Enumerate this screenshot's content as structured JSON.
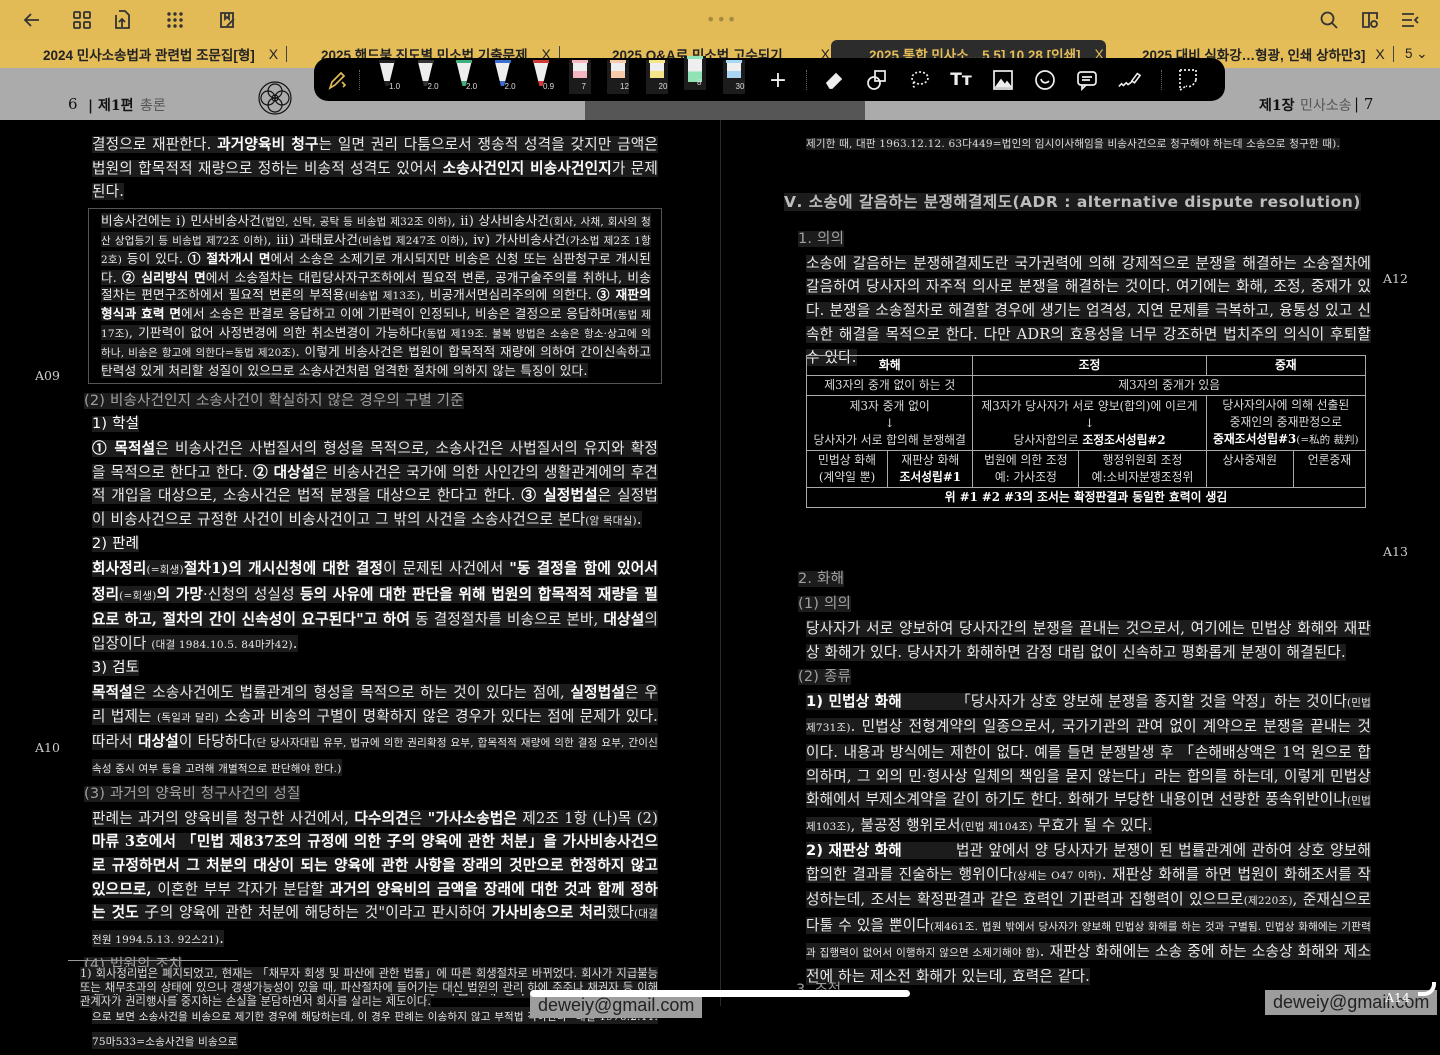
{
  "tabs": [
    {
      "label": "2024 민사소송법과 관련법 조문집[형]",
      "active": false
    },
    {
      "label": "2025 핸드북 진도별 민소법 기출문제",
      "active": false
    },
    {
      "label": "2025 Q&A로 민소법 고수되기",
      "active": false
    },
    {
      "label": "2025 통합 민사소…5 5] 10.28.[인쇄]",
      "active": true
    },
    {
      "label": "2025 대비 심화강…형광, 인쇄 상하만3]",
      "active": false
    }
  ],
  "tab_close": "X",
  "tab_count": "5 ⌄",
  "topbar_dots": "•••",
  "toolbar": {
    "pens": [
      {
        "size": "1.0",
        "color": "#222222",
        "kind": "pen"
      },
      {
        "size": "2.0",
        "color": "#333333",
        "kind": "pen"
      },
      {
        "size": "2.0",
        "color": "#3fae7a",
        "kind": "pen"
      },
      {
        "size": "2.0",
        "color": "#3a6fd0",
        "kind": "pen"
      },
      {
        "size": "0.9",
        "color": "#d23a3a",
        "kind": "pen"
      },
      {
        "size": "7",
        "color": "#f4b6c0",
        "kind": "highlighter"
      },
      {
        "size": "12",
        "color": "#f6c9a8",
        "kind": "highlighter"
      },
      {
        "size": "20",
        "color": "#f4e58a",
        "kind": "highlighter"
      },
      {
        "size": "8",
        "color": "#8fe3b5",
        "kind": "highlighter",
        "selected": true
      },
      {
        "size": "30",
        "color": "#a9d6f2",
        "kind": "highlighter"
      }
    ],
    "add": "+"
  },
  "left_header": {
    "page": "6",
    "part": "제1편",
    "title": "총론"
  },
  "right_header": {
    "chapter": "제1장",
    "title": "민사소송",
    "page": "7"
  },
  "margin_labels": {
    "a09": "A09",
    "a10": "A10",
    "a12": "A12",
    "a13": "A13",
    "a14": "A14"
  },
  "left_blocks": [
    {
      "type": "p",
      "segs": [
        [
          "결정으로 재판한다. "
        ],
        [
          "과거양육비 청구",
          "b"
        ],
        [
          "는 일면 권리 다툼으로서 쟁송적 성격을 갖지만 금액은 법원의 합목적적 재량으로 정하는 비송적 성격도 있어서 "
        ],
        [
          "소송사건인지 비송사건인지",
          "b"
        ],
        [
          "가 문제된다."
        ]
      ]
    },
    {
      "type": "box",
      "segs": [
        [
          "비송사건에는 ⅰ) 민사비송사건"
        ],
        [
          "(법인, 신탁, 공탁 등 비송법 제32조 이하)",
          "s"
        ],
        [
          ", ⅱ) 상사비송사건"
        ],
        [
          "(회사, 사채, 회사의 청산 상업등기 등 비송법 제72조 이하)",
          "s"
        ],
        [
          ", ⅲ) 과태료사건"
        ],
        [
          "(비송법 제247조 이하)",
          "s"
        ],
        [
          ", ⅳ) 가사비송사건"
        ],
        [
          "(가소법 제2조 1항 2호)",
          "s"
        ],
        [
          " 등이 있다. "
        ],
        [
          "① 절차개시 면",
          "b"
        ],
        [
          "에서 소송은 소제기로 개시되지만 비송은 신청 또는 심판청구로 개시된다. "
        ],
        [
          "② 심리방식 면",
          "b"
        ],
        [
          "에서 소송절차는 대립당사자구조하에서 필요적 변론, 공개구술주의를 취하나, 비송절차는 편면구조하에서 필요적 변론의 부적용"
        ],
        [
          "(비송법 제13조)",
          "s"
        ],
        [
          ", 비공개서면심리주의에 의한다. "
        ],
        [
          "③ 재판의 형식과 효력 면",
          "b"
        ],
        [
          "에서 소송은 판결로 응답하고 이에 기판력이 인정되나, 비송은 결정으로 응답하며"
        ],
        [
          "(동법 제17조)",
          "s"
        ],
        [
          ", 기판력이 없어 사정변경에 의한 취소변경이 가능하다"
        ],
        [
          "(동법 제19조. 불복 방법은 소송은 항소·상고에 의하나, 비송은 항고에 의한다=동법 제20조)",
          "s"
        ],
        [
          ". 이렇게 비송사건은 법원이 합목적적 재량에 의하여 간이신속하고 탄력성 있게 처리할 성질이 있으므로 소송사건처럼 엄격한 절차에 의하지 않는 특징이 있다."
        ]
      ]
    },
    {
      "type": "h2",
      "segs": [
        [
          "(2) 비송사건인지 소송사건이 확실하지 않은 경우의 구별 기준"
        ]
      ]
    },
    {
      "type": "h3",
      "segs": [
        [
          "1) 학설"
        ]
      ]
    },
    {
      "type": "p",
      "segs": [
        [
          "① 목적설",
          "b"
        ],
        [
          "은 비송사건은 사법질서의 형성을 목적으로, 소송사건은 사법질서의 유지와 확정을 목적으로 한다고 한다. "
        ],
        [
          "② 대상설",
          "b"
        ],
        [
          "은 비송사건은 국가에 의한 사인간의 생활관계에의 후견적 개입을 대상으로, 소송사건은 법적 분쟁을 대상으로 한다고 한다. "
        ],
        [
          "③ 실정법설",
          "b"
        ],
        [
          "은 실정법이 비송사건으로 규정한 사건이 비송사건이고 그 밖의 사건을 소송사건으로 본다"
        ],
        [
          "(암 목대실)",
          "s"
        ],
        [
          "."
        ]
      ]
    },
    {
      "type": "h3",
      "segs": [
        [
          "2) 판례"
        ]
      ]
    },
    {
      "type": "p",
      "segs": [
        [
          "회사정리",
          "b"
        ],
        [
          "(=회생)",
          "s"
        ],
        [
          "절차1)의 개시신청에 대한 결정",
          "b"
        ],
        [
          "이 문제된 사건에서 "
        ],
        [
          "\"동 결정을 함에 있어서 정리",
          "b"
        ],
        [
          "(=회생)",
          "s"
        ],
        [
          "의 가망",
          "b"
        ],
        [
          "·신청의 성실성 "
        ],
        [
          "등의 사유에 대한 판단을 위해 법원의 합목적적 재량을 필요로 하고, 절차의 간이 신속성이 요구된다\"고 하여",
          "b"
        ],
        [
          " 동 결정절차를 비송으로 본바, "
        ],
        [
          "대상설",
          "b"
        ],
        [
          "의 입장이다 "
        ],
        [
          "(대결 1984.10.5. 84마카42)",
          "s"
        ],
        [
          "."
        ]
      ]
    },
    {
      "type": "h3",
      "segs": [
        [
          "3) 검토"
        ]
      ]
    },
    {
      "type": "p",
      "segs": [
        [
          "목적설",
          "b"
        ],
        [
          "은 소송사건에도 법률관계의 형성을 목적으로 하는 것이 있다는 점에, "
        ],
        [
          "실정법설",
          "b"
        ],
        [
          "은 우리 법제는 "
        ],
        [
          "(독일과 달리)",
          "s"
        ],
        [
          " 소송과 비송의 구별이 명확하지 않은 경우가 있다는 점에 문제가 있다. 따라서 "
        ],
        [
          "대상설",
          "b"
        ],
        [
          "이 타당하다"
        ],
        [
          "(단 당사자대립 유무, 법규에 의한 권리확정 요부, 합목적적 재량에 의한 결정 요부, 간이신속성 중시 여부 등을 고려해 개별적으로 판단해야 한다.)",
          "s"
        ]
      ]
    },
    {
      "type": "h2",
      "segs": [
        [
          "(3) 과거의 양육비 청구사건의 성질"
        ]
      ]
    },
    {
      "type": "p",
      "segs": [
        [
          "판례는 과거의 양육비를 청구한 사건에서, "
        ],
        [
          "다수의견",
          "b"
        ],
        [
          "은 "
        ],
        [
          "\"가사소송법은",
          "b"
        ],
        [
          " 제2조 1항 (나)목 (2)"
        ],
        [
          "마류 3호에서 「민법 제837조의 규정에 의한 子의 양육에 관한 처분」을 가사비송사건으로 규정하면서 그 처분의 대상이 되는 양육에 관한 사항을 장래의 것만으로 한정하지 않고 있으므로,",
          "b"
        ],
        [
          " 이혼한 부부 각자가 분담할 "
        ],
        [
          "과거의 양육비의 금액을 장래에 대한 것과 함께 정하는 것도",
          "b"
        ],
        [
          " 子의 양육에 관한 처분에 해당하는 것\"이라고 판시하여 "
        ],
        [
          "가사비송으로 처리",
          "b"
        ],
        [
          "했다"
        ],
        [
          "(대결 전원 1994.5.13. 92스21)",
          "s"
        ],
        [
          "."
        ]
      ]
    },
    {
      "type": "h2",
      "segs": [
        [
          "(4) 법원의 조치"
        ]
      ]
    },
    {
      "type": "p",
      "segs": [
        [
          "판례처럼 과거양육비의 청구를 비송사건으로 보면 甲은 적법하게 청구한 것이다"
        ],
        [
          "(반면 소송사건으로 보면 소송사건을 비송으로 제기한 경우에 해당하는데, 이 경우 판례는 이송하지 않고 부적법 각하한다=대결 1976.2.11. 75마533=소송사건을 비송으로",
          "s"
        ]
      ]
    }
  ],
  "footnote": "1) 회사정리법은 폐지되었고, 현재는 「채무자 회생 및 파산에 관한 법률」에 따른 회생절차로 바뀌었다. 회사가 지급불능 또는 채무초과의 상태에 있으나 갱생가능성이 있을 때, 파산절차에 들어가는 대신 법원의 관리 하에 주주나 채권자 등 이해관계자가 권리행사를 중지하는 손실을 분담하면서 회사를 살리는 제도이다.",
  "right_blocks": [
    {
      "type": "note",
      "segs": [
        [
          "제기한 때, 대판 1963.12.12. 63다449=법인의 임시이사해임을 비송사건으로 청구해야 하는데 소송으로 청구한 때)."
        ]
      ]
    },
    {
      "type": "h1",
      "segs": [
        [
          "Ⅴ. 소송에 갈음하는 분쟁해결제도(ADR : alternative dispute resolution)"
        ]
      ]
    },
    {
      "type": "h2",
      "segs": [
        [
          "1. 의의"
        ]
      ]
    },
    {
      "type": "p",
      "segs": [
        [
          "소송에 갈음하는 분쟁해결제도란 국가권력에 의해 강제적으로 분쟁을 해결하는 소송절차에 갈음하여 당사자의 자주적 의사로 분쟁을 해결하는 것이다. 여기에는 화해, 조정, 중재가 있다. 분쟁을 소송절차로 해결할 경우에 생기는 엄격성, 지연 문제를 극복하고, 융통성 있고 신속한 해결을 목적으로 한다. 다만 ADR의 효용성을 너무 강조하면 법치주의 의식이 후퇴할 수 있다."
        ]
      ]
    },
    {
      "type": "spacer"
    },
    {
      "type": "h2",
      "segs": [
        [
          "2. 화해"
        ]
      ]
    },
    {
      "type": "h2",
      "segs": [
        [
          "(1) 의의"
        ]
      ]
    },
    {
      "type": "p",
      "segs": [
        [
          "당사자가 서로 양보하여 당사자간의 분쟁을 끝내는 것으로서, 여기에는 민법상 화해와 재판상 화해가 있다. 당사자가 화해하면 감정 대립 없이 신속하고 평화롭게 분쟁이 해결된다."
        ]
      ]
    },
    {
      "type": "h2",
      "segs": [
        [
          "(2) 종류"
        ]
      ]
    },
    {
      "type": "p",
      "segs": [
        [
          "1) 민법상 화해",
          "ih"
        ],
        [
          "「당사자가 상호 양보해 분쟁을 종지할 것을 약정」하는 것이다"
        ],
        [
          "(민법 제731조)",
          "s"
        ],
        [
          ". 민법상 전형계약의 일종으로서, 국가기관의 관여 없이 계약으로 분쟁을 끝내는 것이다. 내용과 방식에는 제한이 없다. 예를 들면 분쟁발생 후 「손해배상액은 1억 원으로 합의하며, 그 외의 민·형사상 일체의 책임을 묻지 않는다」라는 합의를 하는데, 이렇게 민법상 화해에서 부제소계약을 같이 하기도 한다. 화해가 부당한 내용이면 선량한 풍속위반이나"
        ],
        [
          "(민법 제103조)",
          "s"
        ],
        [
          ", 불공정 행위로서"
        ],
        [
          "(민법 제104조)",
          "s"
        ],
        [
          " 무효가 될 수 있다."
        ]
      ]
    },
    {
      "type": "p",
      "segs": [
        [
          "2) 재판상 화해",
          "ih"
        ],
        [
          "법관 앞에서 양 당사자가 분쟁이 된 법률관계에 관하여 상호 양보해 합의한 결과를 진술하는 행위이다"
        ],
        [
          "(상세는 O47 이하)",
          "s"
        ],
        [
          ". 재판상 화해를 하면 법원이 화해조서를 작성하는데, 조서는 확정판결과 같은 효력인 기판력과 집행력이 있으므로"
        ],
        [
          "(제220조)",
          "s"
        ],
        [
          ", 준재심으로 다툴 수 있을 뿐이다"
        ],
        [
          "(제461조. 법원 밖에서 당사자가 양보해 민법상 화해를 하는 것과 구별됨. 민법상 화해에는 기판력과 집행력이 없어서 이행하지 않으면 소제기해야 함)",
          "s"
        ],
        [
          ". 재판상 화해에는 소송 중에 하는 소송상 화해와 제소 전에 하는 제소전 화해가 있는데, 효력은 같다."
        ]
      ]
    }
  ],
  "right_bottom_heading": "3. 조정",
  "adr_table": {
    "headers": [
      "화해",
      "조정",
      "중재"
    ],
    "row1": [
      "제3자의 중개 없이 하는 것",
      "제3자의 중개가 있음"
    ],
    "row2": {
      "c1": [
        "제3자 중개 없이",
        "↓",
        "당사자가 서로 합의해 분쟁해결"
      ],
      "c2": [
        "제3자가 당사자가 서로 양보(합의)에 이르게",
        "↓",
        "당사자합의로 ",
        "조정조서성립#2"
      ],
      "c3": [
        "당사자의사에 의해 선출된",
        "중재인의 중재판정으로",
        "중재조서성립#3",
        "(=私的 裁判)"
      ]
    },
    "row3": [
      [
        "민법상 화해",
        "(계약일 뿐)"
      ],
      [
        "재판상 화해",
        "조서성립#1"
      ],
      [
        "법원에 의한 조정",
        "예: 가사조정"
      ],
      [
        "행정위원회 조정",
        "예:소비자분쟁조정위"
      ],
      [
        "상사중재원"
      ],
      [
        "언론중재"
      ]
    ],
    "footer": "위 #1 #2 #3의 조서는 확정판결과 동일한 효력이 생김"
  },
  "watermark": "deweiy@gmail.com"
}
